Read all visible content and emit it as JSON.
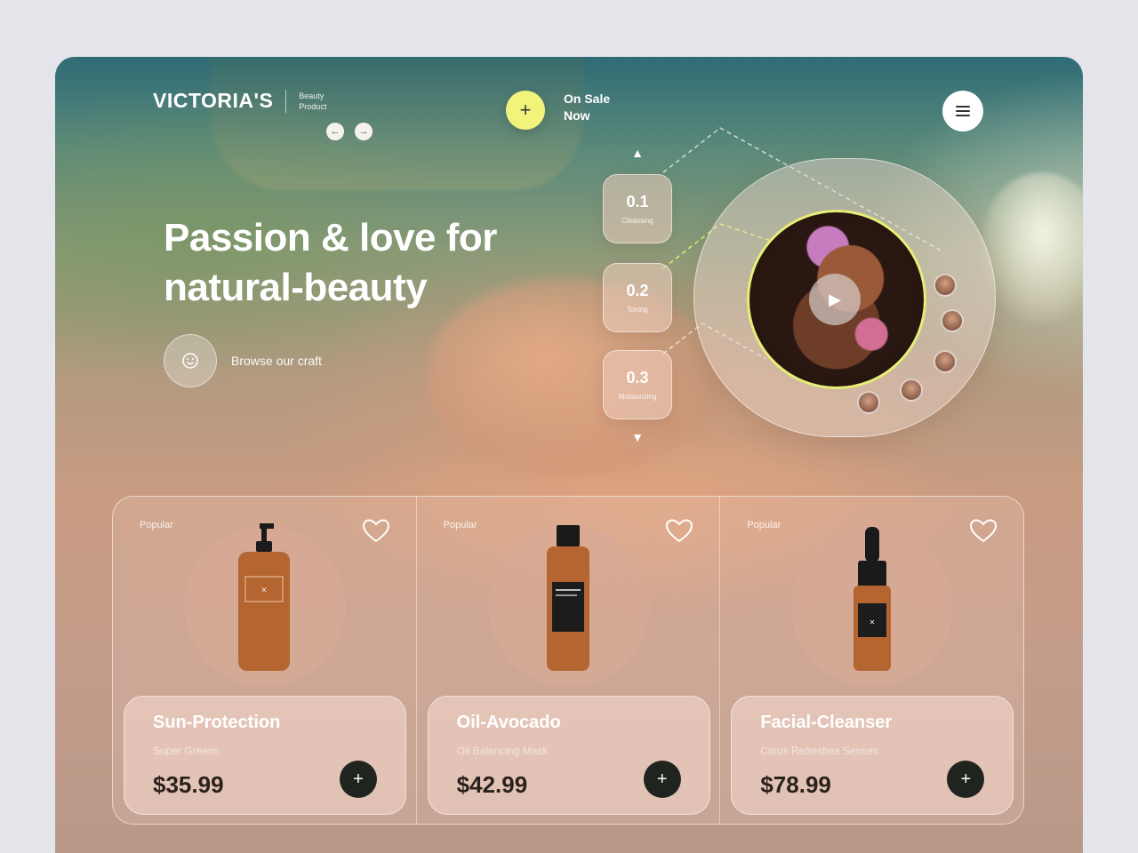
{
  "header": {
    "brand": "VICTORIA'S",
    "tagline": "Beauty Product",
    "prev_icon": "arrow-left",
    "next_icon": "arrow-right",
    "sale_icon": "+",
    "sale_label": "On Sale Now",
    "menu_icon": "hamburger"
  },
  "hero": {
    "title": "Passion & love for natural-beauty",
    "browse_label": "Browse our craft",
    "browse_icon": "smile"
  },
  "steps": {
    "up_icon": "▲",
    "down_icon": "▼",
    "items": [
      {
        "num": "0.1",
        "label": "Cleansing"
      },
      {
        "num": "0.2",
        "label": "Toning"
      },
      {
        "num": "0.3",
        "label": "Moisturizing"
      }
    ]
  },
  "video": {
    "play_icon": "▶",
    "accent": "#e6ee77"
  },
  "products": [
    {
      "tag": "Popular",
      "name": "Sun-Protection",
      "sub": "Super Greens",
      "price": "$35.99",
      "add": "+"
    },
    {
      "tag": "Popular",
      "name": "Oil-Avocado",
      "sub": "Oil Balancing Mask",
      "price": "$42.99",
      "add": "+"
    },
    {
      "tag": "Popular",
      "name": "Facial-Cleanser",
      "sub": "Citrus Refreshes Senses",
      "price": "$78.99",
      "add": "+"
    }
  ],
  "colors": {
    "sale_button": "#f2f37a",
    "add_button": "#1f241f",
    "bottle": "#b5652f"
  }
}
